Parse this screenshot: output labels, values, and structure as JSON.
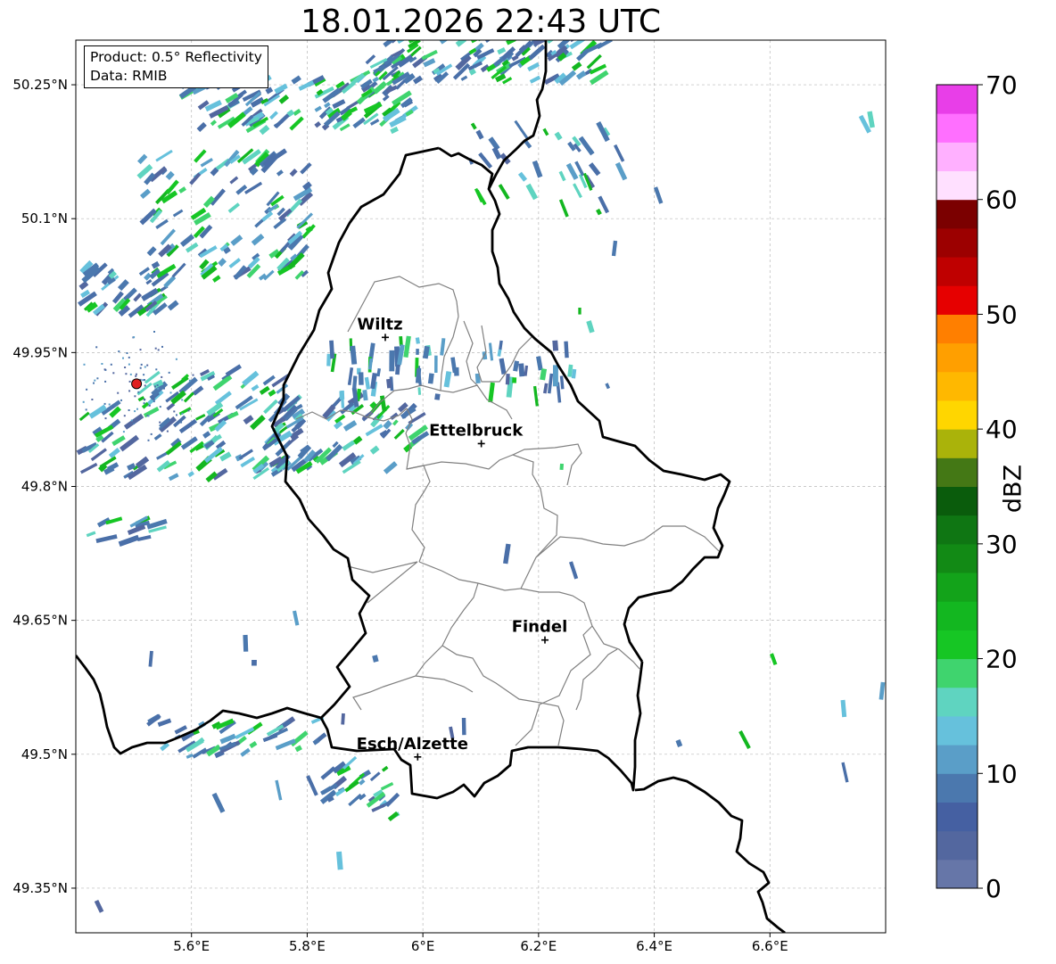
{
  "title": "18.01.2026 22:43 UTC",
  "info": {
    "product": "Product: 0.5° Reflectivity",
    "data": "Data: RMIB"
  },
  "map": {
    "extent": {
      "lon": [
        5.4,
        6.8
      ],
      "lat": [
        49.3,
        50.3
      ]
    },
    "lat_ticks": [
      {
        "value": 50.25,
        "label": "50.25°N"
      },
      {
        "value": 50.1,
        "label": "50.1°N"
      },
      {
        "value": 49.95,
        "label": "49.95°N"
      },
      {
        "value": 49.8,
        "label": "49.8°N"
      },
      {
        "value": 49.65,
        "label": "49.65°N"
      },
      {
        "value": 49.5,
        "label": "49.5°N"
      },
      {
        "value": 49.35,
        "label": "49.35°N"
      }
    ],
    "lon_ticks": [
      {
        "value": 5.6,
        "label": "5.6°E"
      },
      {
        "value": 5.8,
        "label": "5.8°E"
      },
      {
        "value": 6.0,
        "label": "6°E"
      },
      {
        "value": 6.2,
        "label": "6.2°E"
      },
      {
        "value": 6.4,
        "label": "6.4°E"
      },
      {
        "value": 6.6,
        "label": "6.6°E"
      }
    ],
    "cities": [
      {
        "name": "Wiltz",
        "lon": 5.935,
        "lat": 49.967
      },
      {
        "name": "Ettelbruck",
        "lon": 6.101,
        "lat": 49.848
      },
      {
        "name": "Findel",
        "lon": 6.211,
        "lat": 49.628
      },
      {
        "name": "Esch/Alzette",
        "lon": 5.991,
        "lat": 49.497
      }
    ],
    "radar_site": {
      "lon": 5.505,
      "lat": 49.915
    }
  },
  "colorbar": {
    "label": "dBZ",
    "min": 0,
    "max": 70,
    "step": 2.5,
    "ticks": [
      {
        "value": 0,
        "label": "0"
      },
      {
        "value": 10,
        "label": "10"
      },
      {
        "value": 20,
        "label": "20"
      },
      {
        "value": 30,
        "label": "30"
      },
      {
        "value": 40,
        "label": "40"
      },
      {
        "value": 50,
        "label": "50"
      },
      {
        "value": 60,
        "label": "60"
      },
      {
        "value": 70,
        "label": "70"
      }
    ],
    "colors": [
      "#6676a8",
      "#53679f",
      "#4560a2",
      "#4b78ae",
      "#5a9ec8",
      "#66c1dc",
      "#5fd4c0",
      "#3fd46e",
      "#16c624",
      "#13b720",
      "#13a31a",
      "#128a15",
      "#0f7613",
      "#0a5c0c",
      "#447815",
      "#aab30a",
      "#ffd600",
      "#ffb800",
      "#ff9f00",
      "#ff7f00",
      "#e60000",
      "#bf0000",
      "#9c0000",
      "#7b0000",
      "#ffe0ff",
      "#ffb0ff",
      "#ff6fff",
      "#e83ee8"
    ]
  }
}
